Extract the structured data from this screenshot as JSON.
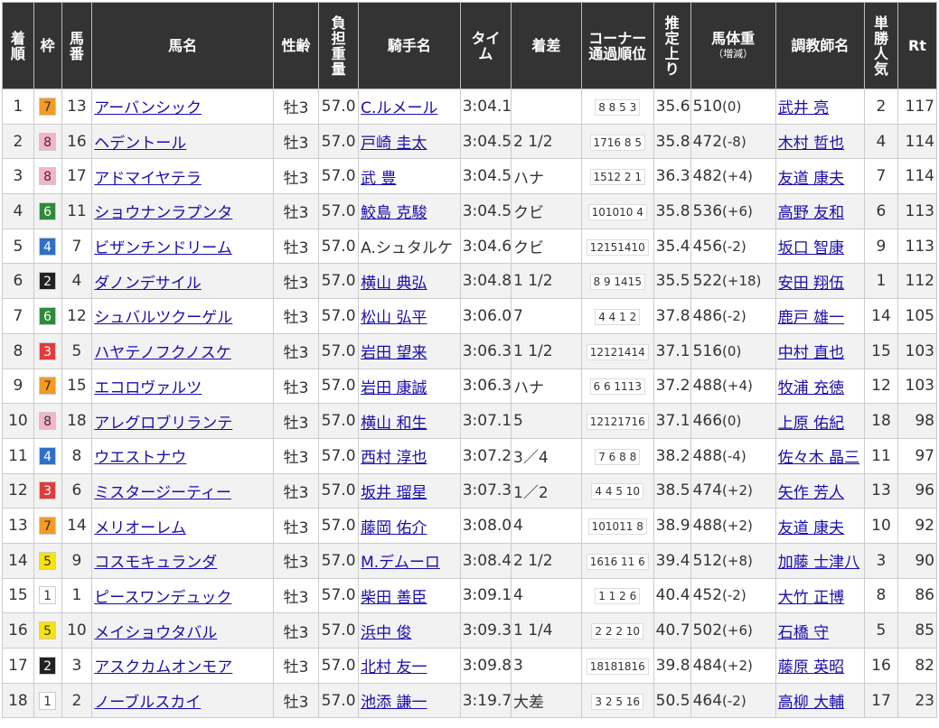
{
  "headers": {
    "rank": "着順",
    "waku": "枠",
    "umaban": "馬番",
    "horse": "馬名",
    "sexage": "性齢",
    "weight_carried": "負担重量",
    "jockey": "騎手名",
    "time": "タイム",
    "margin": "着差",
    "corner_line1": "コーナー",
    "corner_line2": "通過順位",
    "last3f": "推定上り",
    "body_weight_line1": "馬体重",
    "body_weight_line2": "（増減）",
    "trainer": "調教師名",
    "popularity": "単勝人気",
    "rating": "Rt"
  },
  "waku_colors": {
    "1": {
      "bg": "#ffffff",
      "fg": "#333333"
    },
    "2": {
      "bg": "#222222",
      "fg": "#ffffff"
    },
    "3": {
      "bg": "#e03c3c",
      "fg": "#ffffff"
    },
    "4": {
      "bg": "#2f6fc9",
      "fg": "#ffffff"
    },
    "5": {
      "bg": "#f6e30e",
      "fg": "#333333"
    },
    "6": {
      "bg": "#2e8b3a",
      "fg": "#ffffff"
    },
    "7": {
      "bg": "#f49a26",
      "fg": "#333333"
    },
    "8": {
      "bg": "#f6b3c8",
      "fg": "#333333"
    }
  },
  "rows": [
    {
      "rank": "1",
      "waku": "7",
      "umaban": "13",
      "horse": "アーバンシック",
      "sexage": "牡3",
      "weight": "57.0",
      "jockey": "C.ルメール",
      "jockey_link": true,
      "time": "3:04.1",
      "margin": "",
      "corner": "8 8 5 3",
      "last3f": "35.6",
      "bw": "510",
      "bwd": "(0)",
      "trainer": "武井 亮",
      "pop": "2",
      "rt": "117"
    },
    {
      "rank": "2",
      "waku": "8",
      "umaban": "16",
      "horse": "ヘデントール",
      "sexage": "牡3",
      "weight": "57.0",
      "jockey": "戸崎 圭太",
      "jockey_link": true,
      "time": "3:04.5",
      "margin": "2 1/2",
      "corner": "1716 8 5",
      "last3f": "35.8",
      "bw": "472",
      "bwd": "(-8)",
      "trainer": "木村 哲也",
      "pop": "4",
      "rt": "114"
    },
    {
      "rank": "3",
      "waku": "8",
      "umaban": "17",
      "horse": "アドマイヤテラ",
      "sexage": "牡3",
      "weight": "57.0",
      "jockey": "武 豊",
      "jockey_link": true,
      "time": "3:04.5",
      "margin": "ハナ",
      "corner": "1512 2 1",
      "last3f": "36.3",
      "bw": "482",
      "bwd": "(+4)",
      "trainer": "友道 康夫",
      "pop": "7",
      "rt": "114"
    },
    {
      "rank": "4",
      "waku": "6",
      "umaban": "11",
      "horse": "ショウナンラプンタ",
      "sexage": "牡3",
      "weight": "57.0",
      "jockey": "鮫島 克駿",
      "jockey_link": true,
      "time": "3:04.5",
      "margin": "クビ",
      "corner": "101010 4",
      "last3f": "35.8",
      "bw": "536",
      "bwd": "(+6)",
      "trainer": "高野 友和",
      "pop": "6",
      "rt": "113"
    },
    {
      "rank": "5",
      "waku": "4",
      "umaban": "7",
      "horse": "ビザンチンドリーム",
      "sexage": "牡3",
      "weight": "57.0",
      "jockey": "A.シュタルケ",
      "jockey_link": false,
      "time": "3:04.6",
      "margin": "クビ",
      "corner": "12151410",
      "last3f": "35.4",
      "bw": "456",
      "bwd": "(-2)",
      "trainer": "坂口 智康",
      "pop": "9",
      "rt": "113"
    },
    {
      "rank": "6",
      "waku": "2",
      "umaban": "4",
      "horse": "ダノンデサイル",
      "sexage": "牡3",
      "weight": "57.0",
      "jockey": "横山 典弘",
      "jockey_link": true,
      "time": "3:04.8",
      "margin": "1 1/2",
      "corner": "8 9 1415",
      "last3f": "35.5",
      "bw": "522",
      "bwd": "(+18)",
      "trainer": "安田 翔伍",
      "pop": "1",
      "rt": "112"
    },
    {
      "rank": "7",
      "waku": "6",
      "umaban": "12",
      "horse": "シュバルツクーゲル",
      "sexage": "牡3",
      "weight": "57.0",
      "jockey": "松山 弘平",
      "jockey_link": true,
      "time": "3:06.0",
      "margin": "7",
      "corner": "4 4 1 2",
      "last3f": "37.8",
      "bw": "486",
      "bwd": "(-2)",
      "trainer": "鹿戸 雄一",
      "pop": "14",
      "rt": "105"
    },
    {
      "rank": "8",
      "waku": "3",
      "umaban": "5",
      "horse": "ハヤテノフクノスケ",
      "sexage": "牡3",
      "weight": "57.0",
      "jockey": "岩田 望来",
      "jockey_link": true,
      "time": "3:06.3",
      "margin": "1 1/2",
      "corner": "12121414",
      "last3f": "37.1",
      "bw": "516",
      "bwd": "(0)",
      "trainer": "中村 直也",
      "pop": "15",
      "rt": "103"
    },
    {
      "rank": "9",
      "waku": "7",
      "umaban": "15",
      "horse": "エコロヴァルツ",
      "sexage": "牡3",
      "weight": "57.0",
      "jockey": "岩田 康誠",
      "jockey_link": true,
      "time": "3:06.3",
      "margin": "ハナ",
      "corner": "6 6 1113",
      "last3f": "37.2",
      "bw": "488",
      "bwd": "(+4)",
      "trainer": "牧浦 充徳",
      "pop": "12",
      "rt": "103"
    },
    {
      "rank": "10",
      "waku": "8",
      "umaban": "18",
      "horse": "アレグロブリランテ",
      "sexage": "牡3",
      "weight": "57.0",
      "jockey": "横山 和生",
      "jockey_link": true,
      "time": "3:07.1",
      "margin": "5",
      "corner": "12121716",
      "last3f": "37.1",
      "bw": "466",
      "bwd": "(0)",
      "trainer": "上原 佑紀",
      "pop": "18",
      "rt": "98"
    },
    {
      "rank": "11",
      "waku": "4",
      "umaban": "8",
      "horse": "ウエストナウ",
      "sexage": "牡3",
      "weight": "57.0",
      "jockey": "西村 淳也",
      "jockey_link": true,
      "time": "3:07.2",
      "margin": "3／4",
      "corner": "7 6 8 8",
      "last3f": "38.2",
      "bw": "488",
      "bwd": "(-4)",
      "trainer": "佐々木 晶三",
      "pop": "11",
      "rt": "97"
    },
    {
      "rank": "12",
      "waku": "3",
      "umaban": "6",
      "horse": "ミスタージーティー",
      "sexage": "牡3",
      "weight": "57.0",
      "jockey": "坂井 瑠星",
      "jockey_link": true,
      "time": "3:07.3",
      "margin": "1／2",
      "corner": "4 4 5 10",
      "last3f": "38.5",
      "bw": "474",
      "bwd": "(+2)",
      "trainer": "矢作 芳人",
      "pop": "13",
      "rt": "96"
    },
    {
      "rank": "13",
      "waku": "7",
      "umaban": "14",
      "horse": "メリオーレム",
      "sexage": "牡3",
      "weight": "57.0",
      "jockey": "藤岡 佑介",
      "jockey_link": true,
      "time": "3:08.0",
      "margin": "4",
      "corner": "101011 8",
      "last3f": "38.9",
      "bw": "488",
      "bwd": "(+2)",
      "trainer": "友道 康夫",
      "pop": "10",
      "rt": "92"
    },
    {
      "rank": "14",
      "waku": "5",
      "umaban": "9",
      "horse": "コスモキュランダ",
      "sexage": "牡3",
      "weight": "57.0",
      "jockey": "M.デムーロ",
      "jockey_link": true,
      "time": "3:08.4",
      "margin": "2 1/2",
      "corner": "1616 11 6",
      "last3f": "39.4",
      "bw": "512",
      "bwd": "(+8)",
      "trainer": "加藤 士津八",
      "pop": "3",
      "rt": "90"
    },
    {
      "rank": "15",
      "waku": "1",
      "umaban": "1",
      "horse": "ピースワンデュック",
      "sexage": "牡3",
      "weight": "57.0",
      "jockey": "柴田 善臣",
      "jockey_link": true,
      "time": "3:09.1",
      "margin": "4",
      "corner": "1 1 2 6",
      "last3f": "40.4",
      "bw": "452",
      "bwd": "(-2)",
      "trainer": "大竹 正博",
      "pop": "8",
      "rt": "86"
    },
    {
      "rank": "16",
      "waku": "5",
      "umaban": "10",
      "horse": "メイショウタバル",
      "sexage": "牡3",
      "weight": "57.0",
      "jockey": "浜中 俊",
      "jockey_link": true,
      "time": "3:09.3",
      "margin": "1 1/4",
      "corner": "2 2 2 10",
      "last3f": "40.7",
      "bw": "502",
      "bwd": "(+6)",
      "trainer": "石橋 守",
      "pop": "5",
      "rt": "85"
    },
    {
      "rank": "17",
      "waku": "2",
      "umaban": "3",
      "horse": "アスクカムオンモア",
      "sexage": "牡3",
      "weight": "57.0",
      "jockey": "北村 友一",
      "jockey_link": true,
      "time": "3:09.8",
      "margin": "3",
      "corner": "18181816",
      "last3f": "39.8",
      "bw": "484",
      "bwd": "(+2)",
      "trainer": "藤原 英昭",
      "pop": "16",
      "rt": "82"
    },
    {
      "rank": "18",
      "waku": "1",
      "umaban": "2",
      "horse": "ノーブルスカイ",
      "sexage": "牡3",
      "weight": "57.0",
      "jockey": "池添 謙一",
      "jockey_link": true,
      "time": "3:19.7",
      "margin": "大差",
      "corner": "3 2 5 16",
      "last3f": "50.5",
      "bw": "464",
      "bwd": "(-2)",
      "trainer": "高柳 大輔",
      "pop": "17",
      "rt": "23"
    }
  ]
}
